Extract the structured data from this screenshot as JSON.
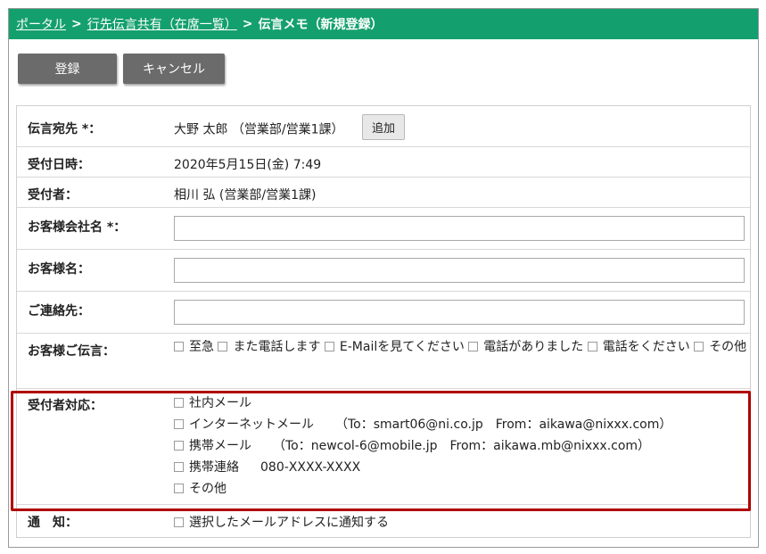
{
  "breadcrumb": {
    "portal": "ポータル",
    "list": "行先伝言共有（在席一覧）",
    "current": "伝言メモ（新規登録）",
    "separator": ">"
  },
  "toolbar": {
    "register_label": "登録",
    "cancel_label": "キャンセル"
  },
  "form": {
    "destination": {
      "label": "伝言宛先 *：",
      "value": "大野 太郎 （営業部/営業1課）",
      "add_label": "追加"
    },
    "received_at": {
      "label": "受付日時：",
      "value": "2020年5月15日(金) 7:49"
    },
    "receiver": {
      "label": "受付者：",
      "value": "相川 弘 (営業部/営業1課)"
    },
    "company": {
      "label": "お客様会社名 *：",
      "value": ""
    },
    "customer_name": {
      "label": "お客様名：",
      "value": ""
    },
    "contact": {
      "label": "ご連絡先：",
      "value": ""
    },
    "customer_message": {
      "label": "お客様ご伝言：",
      "options": [
        "至急",
        "また電話します",
        "E-Mailを見てください",
        "電話がありました",
        "電話をください",
        "その他"
      ]
    },
    "response": {
      "label": "受付者対応：",
      "options": [
        {
          "name": "社内メール",
          "detail": ""
        },
        {
          "name": "インターネットメール",
          "detail": "（To：smart06@ni.co.jp　From：aikawa@nixxx.com）"
        },
        {
          "name": "携帯メール",
          "detail": "（To：newcol-6@mobile.jp　From：aikawa.mb@nixxx.com）"
        },
        {
          "name": "携帯連絡",
          "detail": "080-XXXX-XXXX"
        },
        {
          "name": "その他",
          "detail": ""
        }
      ]
    },
    "notify": {
      "label": "通　知：",
      "option": "選択したメールアドレスに通知する"
    }
  },
  "colors": {
    "header_bg": "#14a06e",
    "button_bg": "#6b6b6b",
    "highlight": "#b00000"
  }
}
